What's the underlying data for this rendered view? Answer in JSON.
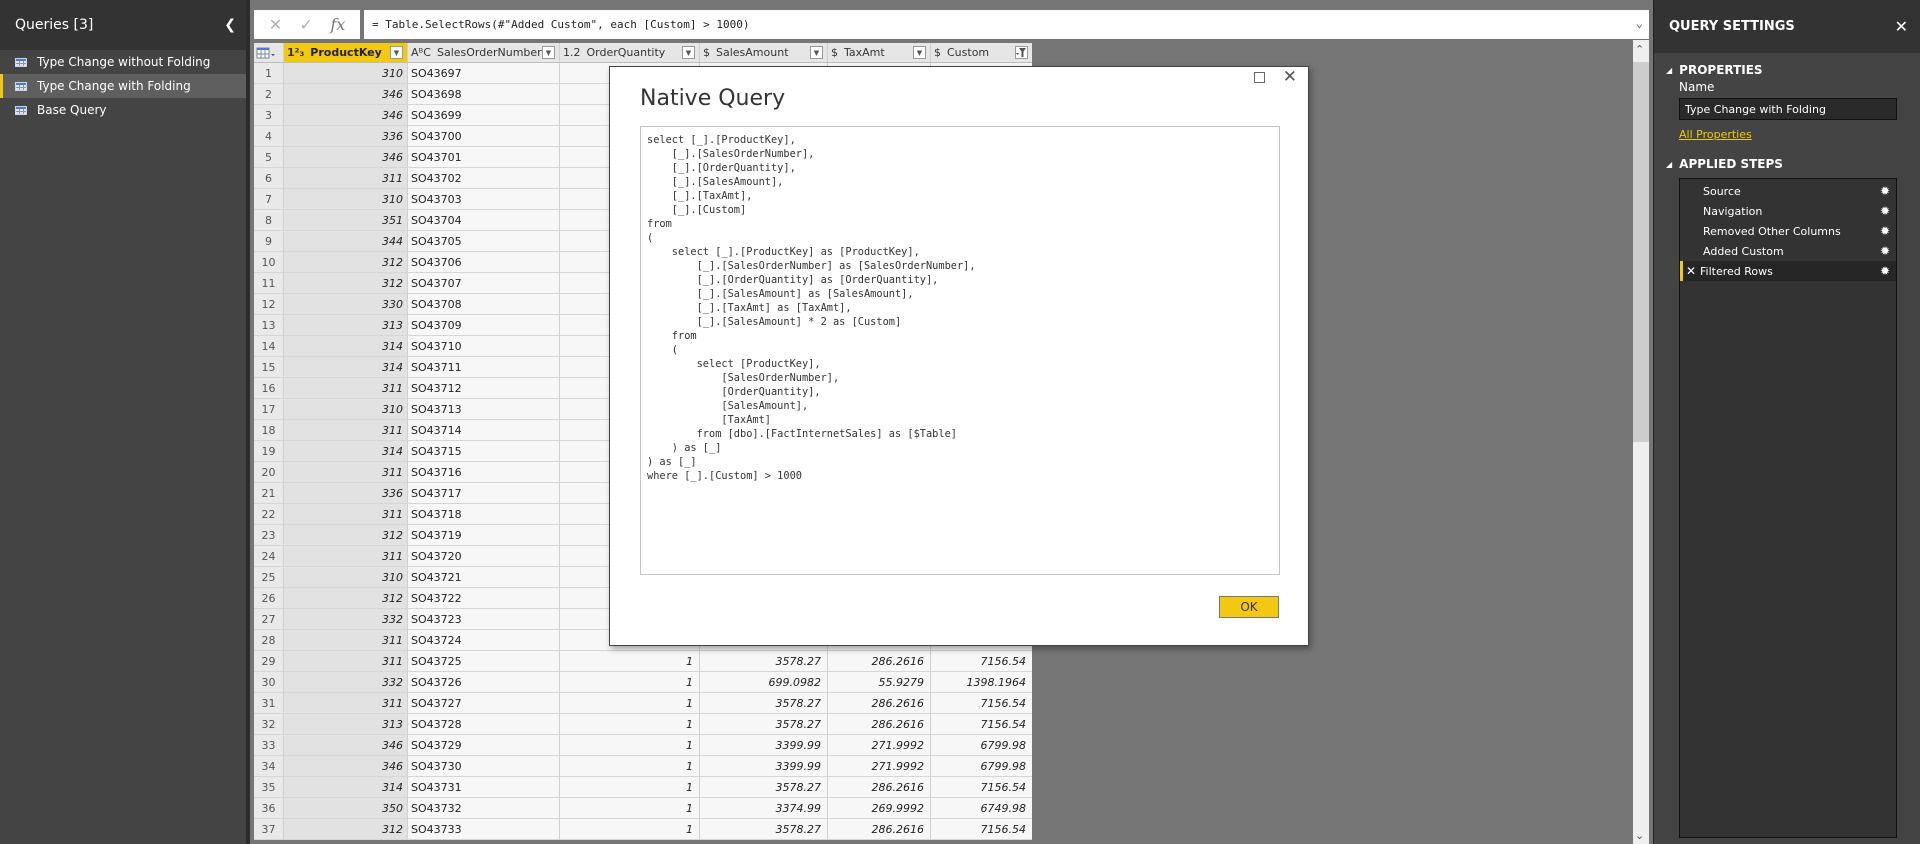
{
  "queries_pane": {
    "title": "Queries [3]",
    "collapse_icon": "chevron-left-icon",
    "items": [
      {
        "label": "Type Change without Folding",
        "icon": "table-icon",
        "selected": false
      },
      {
        "label": "Type Change with Folding",
        "icon": "table-icon",
        "selected": true
      },
      {
        "label": "Base Query",
        "icon": "table-icon",
        "selected": false
      }
    ]
  },
  "formula_bar": {
    "cancel_icon": "✕",
    "commit_icon": "✓",
    "fx_label": "fx",
    "formula": "= Table.SelectRows(#\"Added Custom\", each [Custom] > 1000)",
    "expand_icon": "chevron-down-icon"
  },
  "grid": {
    "columns": [
      {
        "type": "1²₃",
        "name": "ProductKey",
        "filter_icon": "dropdown-icon"
      },
      {
        "type": "AᴮC",
        "name": "SalesOrderNumber",
        "filter_icon": "dropdown-icon"
      },
      {
        "type": "1.2",
        "name": "OrderQuantity",
        "filter_icon": "dropdown-icon"
      },
      {
        "type": "$",
        "name": "SalesAmount",
        "filter_icon": "dropdown-icon"
      },
      {
        "type": "$",
        "name": "TaxAmt",
        "filter_icon": "dropdown-icon"
      },
      {
        "type": "$",
        "name": "Custom",
        "filter_icon": "filter-applied-icon"
      }
    ],
    "rows": [
      [
        "1",
        "310",
        "SO43697",
        "",
        "",
        "",
        ""
      ],
      [
        "2",
        "346",
        "SO43698",
        "",
        "",
        "",
        ""
      ],
      [
        "3",
        "346",
        "SO43699",
        "",
        "",
        "",
        ""
      ],
      [
        "4",
        "336",
        "SO43700",
        "",
        "",
        "",
        ""
      ],
      [
        "5",
        "346",
        "SO43701",
        "",
        "",
        "",
        ""
      ],
      [
        "6",
        "311",
        "SO43702",
        "",
        "",
        "",
        ""
      ],
      [
        "7",
        "310",
        "SO43703",
        "",
        "",
        "",
        ""
      ],
      [
        "8",
        "351",
        "SO43704",
        "",
        "",
        "",
        ""
      ],
      [
        "9",
        "344",
        "SO43705",
        "",
        "",
        "",
        ""
      ],
      [
        "10",
        "312",
        "SO43706",
        "",
        "",
        "",
        ""
      ],
      [
        "11",
        "312",
        "SO43707",
        "",
        "",
        "",
        ""
      ],
      [
        "12",
        "330",
        "SO43708",
        "",
        "",
        "",
        ""
      ],
      [
        "13",
        "313",
        "SO43709",
        "",
        "",
        "",
        ""
      ],
      [
        "14",
        "314",
        "SO43710",
        "",
        "",
        "",
        ""
      ],
      [
        "15",
        "314",
        "SO43711",
        "",
        "",
        "",
        ""
      ],
      [
        "16",
        "311",
        "SO43712",
        "",
        "",
        "",
        ""
      ],
      [
        "17",
        "310",
        "SO43713",
        "",
        "",
        "",
        ""
      ],
      [
        "18",
        "311",
        "SO43714",
        "",
        "",
        "",
        ""
      ],
      [
        "19",
        "314",
        "SO43715",
        "",
        "",
        "",
        ""
      ],
      [
        "20",
        "311",
        "SO43716",
        "",
        "",
        "",
        ""
      ],
      [
        "21",
        "336",
        "SO43717",
        "",
        "",
        "",
        ""
      ],
      [
        "22",
        "311",
        "SO43718",
        "",
        "",
        "",
        ""
      ],
      [
        "23",
        "312",
        "SO43719",
        "",
        "",
        "",
        ""
      ],
      [
        "24",
        "311",
        "SO43720",
        "",
        "",
        "",
        ""
      ],
      [
        "25",
        "310",
        "SO43721",
        "",
        "",
        "",
        ""
      ],
      [
        "26",
        "312",
        "SO43722",
        "",
        "",
        "",
        ""
      ],
      [
        "27",
        "332",
        "SO43723",
        "",
        "",
        "",
        ""
      ],
      [
        "28",
        "311",
        "SO43724",
        "",
        "",
        "",
        ""
      ],
      [
        "29",
        "311",
        "SO43725",
        "1",
        "3578.27",
        "286.2616",
        "7156.54"
      ],
      [
        "30",
        "332",
        "SO43726",
        "1",
        "699.0982",
        "55.9279",
        "1398.1964"
      ],
      [
        "31",
        "311",
        "SO43727",
        "1",
        "3578.27",
        "286.2616",
        "7156.54"
      ],
      [
        "32",
        "313",
        "SO43728",
        "1",
        "3578.27",
        "286.2616",
        "7156.54"
      ],
      [
        "33",
        "346",
        "SO43729",
        "1",
        "3399.99",
        "271.9992",
        "6799.98"
      ],
      [
        "34",
        "346",
        "SO43730",
        "1",
        "3399.99",
        "271.9992",
        "6799.98"
      ],
      [
        "35",
        "314",
        "SO43731",
        "1",
        "3578.27",
        "286.2616",
        "7156.54"
      ],
      [
        "36",
        "350",
        "SO43732",
        "1",
        "3374.99",
        "269.9992",
        "6749.98"
      ],
      [
        "37",
        "312",
        "SO43733",
        "1",
        "3578.27",
        "286.2616",
        "7156.54"
      ]
    ]
  },
  "dialog": {
    "title": "Native Query",
    "maximize_icon": "maximize-icon",
    "close_icon": "close-icon",
    "sql": "select [_].[ProductKey],\n    [_].[SalesOrderNumber],\n    [_].[OrderQuantity],\n    [_].[SalesAmount],\n    [_].[TaxAmt],\n    [_].[Custom]\nfrom\n(\n    select [_].[ProductKey] as [ProductKey],\n        [_].[SalesOrderNumber] as [SalesOrderNumber],\n        [_].[OrderQuantity] as [OrderQuantity],\n        [_].[SalesAmount] as [SalesAmount],\n        [_].[TaxAmt] as [TaxAmt],\n        [_].[SalesAmount] * 2 as [Custom]\n    from\n    (\n        select [ProductKey],\n            [SalesOrderNumber],\n            [OrderQuantity],\n            [SalesAmount],\n            [TaxAmt]\n        from [dbo].[FactInternetSales] as [$Table]\n    ) as [_]\n) as [_]\nwhere [_].[Custom] > 1000",
    "ok_label": "OK"
  },
  "settings_pane": {
    "title": "QUERY SETTINGS",
    "close_icon": "✕",
    "properties_title": "PROPERTIES",
    "name_label": "Name",
    "name_value": "Type Change with Folding",
    "all_properties_link": "All Properties",
    "applied_steps_title": "APPLIED STEPS",
    "steps": [
      {
        "label": "Source",
        "selected": false
      },
      {
        "label": "Navigation",
        "selected": false
      },
      {
        "label": "Removed Other Columns",
        "selected": false
      },
      {
        "label": "Added Custom",
        "selected": false
      },
      {
        "label": "Filtered Rows",
        "selected": true
      }
    ]
  },
  "colors": {
    "accent": "#f2c811",
    "pane_bg": "#444444",
    "header_bg": "#333333",
    "workspace_bg": "#767676"
  }
}
